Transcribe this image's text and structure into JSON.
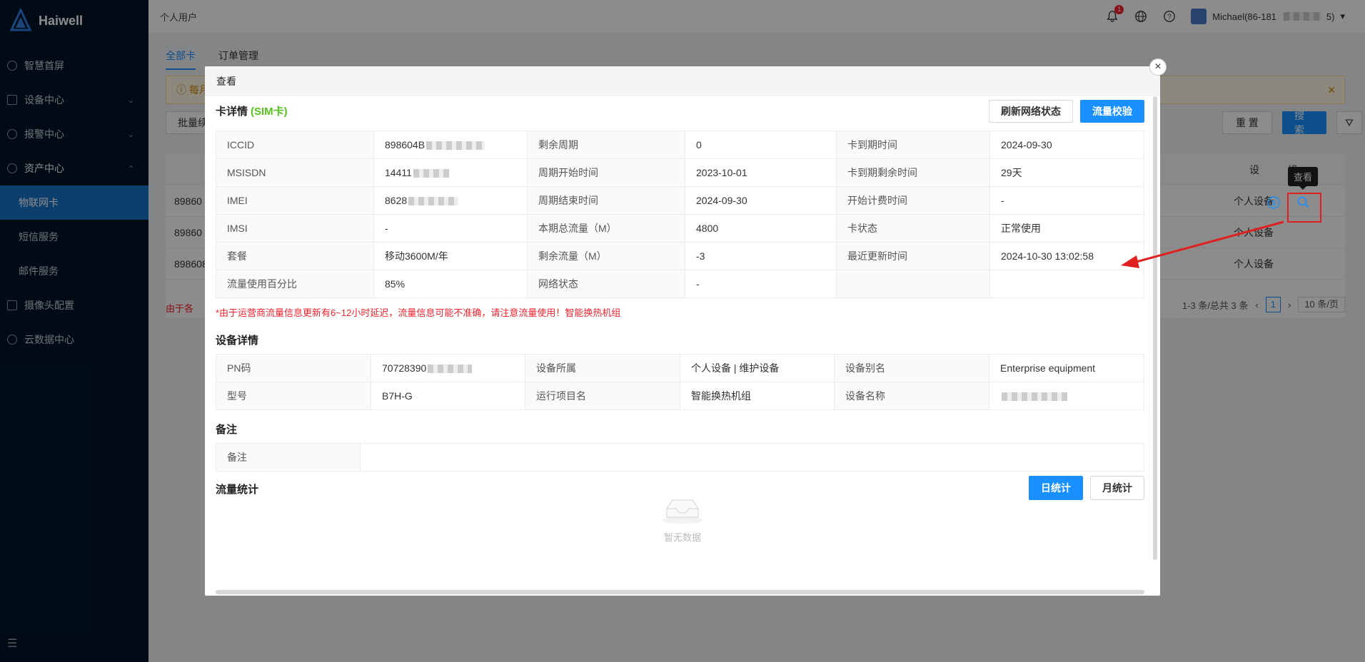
{
  "brand": {
    "name": "Haiwell"
  },
  "sidebar": {
    "items": [
      {
        "label": "智慧首屏"
      },
      {
        "label": "设备中心"
      },
      {
        "label": "报警中心"
      },
      {
        "label": "资产中心"
      },
      {
        "label": "物联网卡"
      },
      {
        "label": "短信服务"
      },
      {
        "label": "邮件服务"
      },
      {
        "label": "摄像头配置"
      },
      {
        "label": "云数据中心"
      }
    ]
  },
  "header": {
    "crumb": "个人用户",
    "bell_badge": "1",
    "user": "Michael(86-181",
    "user_tail": "5)"
  },
  "page": {
    "tabs": [
      "全部卡",
      "订单管理"
    ],
    "notice": "每月",
    "batch_button": "批量续",
    "reset_button": "重 置",
    "search_button": "搜 索",
    "rows": [
      "89860",
      "89860",
      "898608"
    ],
    "row_owner": "个人设备",
    "col_device": "设",
    "col_action": "操",
    "warn": "由于各",
    "pager_total": "1-3 条/总共 3 条",
    "pager_page": "1",
    "pager_size": "10 条/页",
    "tooltip": "查看"
  },
  "modal": {
    "title": "查看",
    "close": "×",
    "card_section": "卡详情",
    "card_type": "(SIM卡)",
    "refresh_button": "刷新网络状态",
    "verify_button": "流量校验",
    "card_rows": [
      [
        "ICCID",
        "898604B",
        "剩余周期",
        "0",
        "卡到期时间",
        "2024-09-30"
      ],
      [
        "MSISDN",
        "14411",
        "周期开始时间",
        "2023-10-01",
        "卡到期剩余时间",
        "29天"
      ],
      [
        "IMEI",
        "8628",
        "周期结束时间",
        "2024-09-30",
        "开始计费时间",
        "-"
      ],
      [
        "IMSI",
        "-",
        "本期总流量（M）",
        "4800",
        "卡状态",
        "正常使用"
      ],
      [
        "套餐",
        "移动3600M/年",
        "剩余流量（M）",
        "-3",
        "最近更新时间",
        "2024-10-30 13:02:58"
      ],
      [
        "流量使用百分比",
        "85%",
        "网络状态",
        "-",
        "",
        ""
      ]
    ],
    "red_note": "*由于运营商流量信息更新有6~12小时延迟，流量信息可能不准确，请注意流量使用！智能换热机组",
    "device_section": "设备详情",
    "device_rows": [
      [
        "PN码",
        "70728390",
        "设备所属",
        "个人设备 | 维护设备",
        "设备别名",
        "Enterprise equipment"
      ],
      [
        "型号",
        "B7H-G",
        "运行项目名",
        "智能换热机组",
        "设备名称",
        ""
      ]
    ],
    "remark_section": "备注",
    "remark_label": "备注",
    "remark_value": "",
    "flow_section": "流量统计",
    "daily_button": "日统计",
    "monthly_button": "月统计",
    "empty_text": "暂无数据"
  }
}
